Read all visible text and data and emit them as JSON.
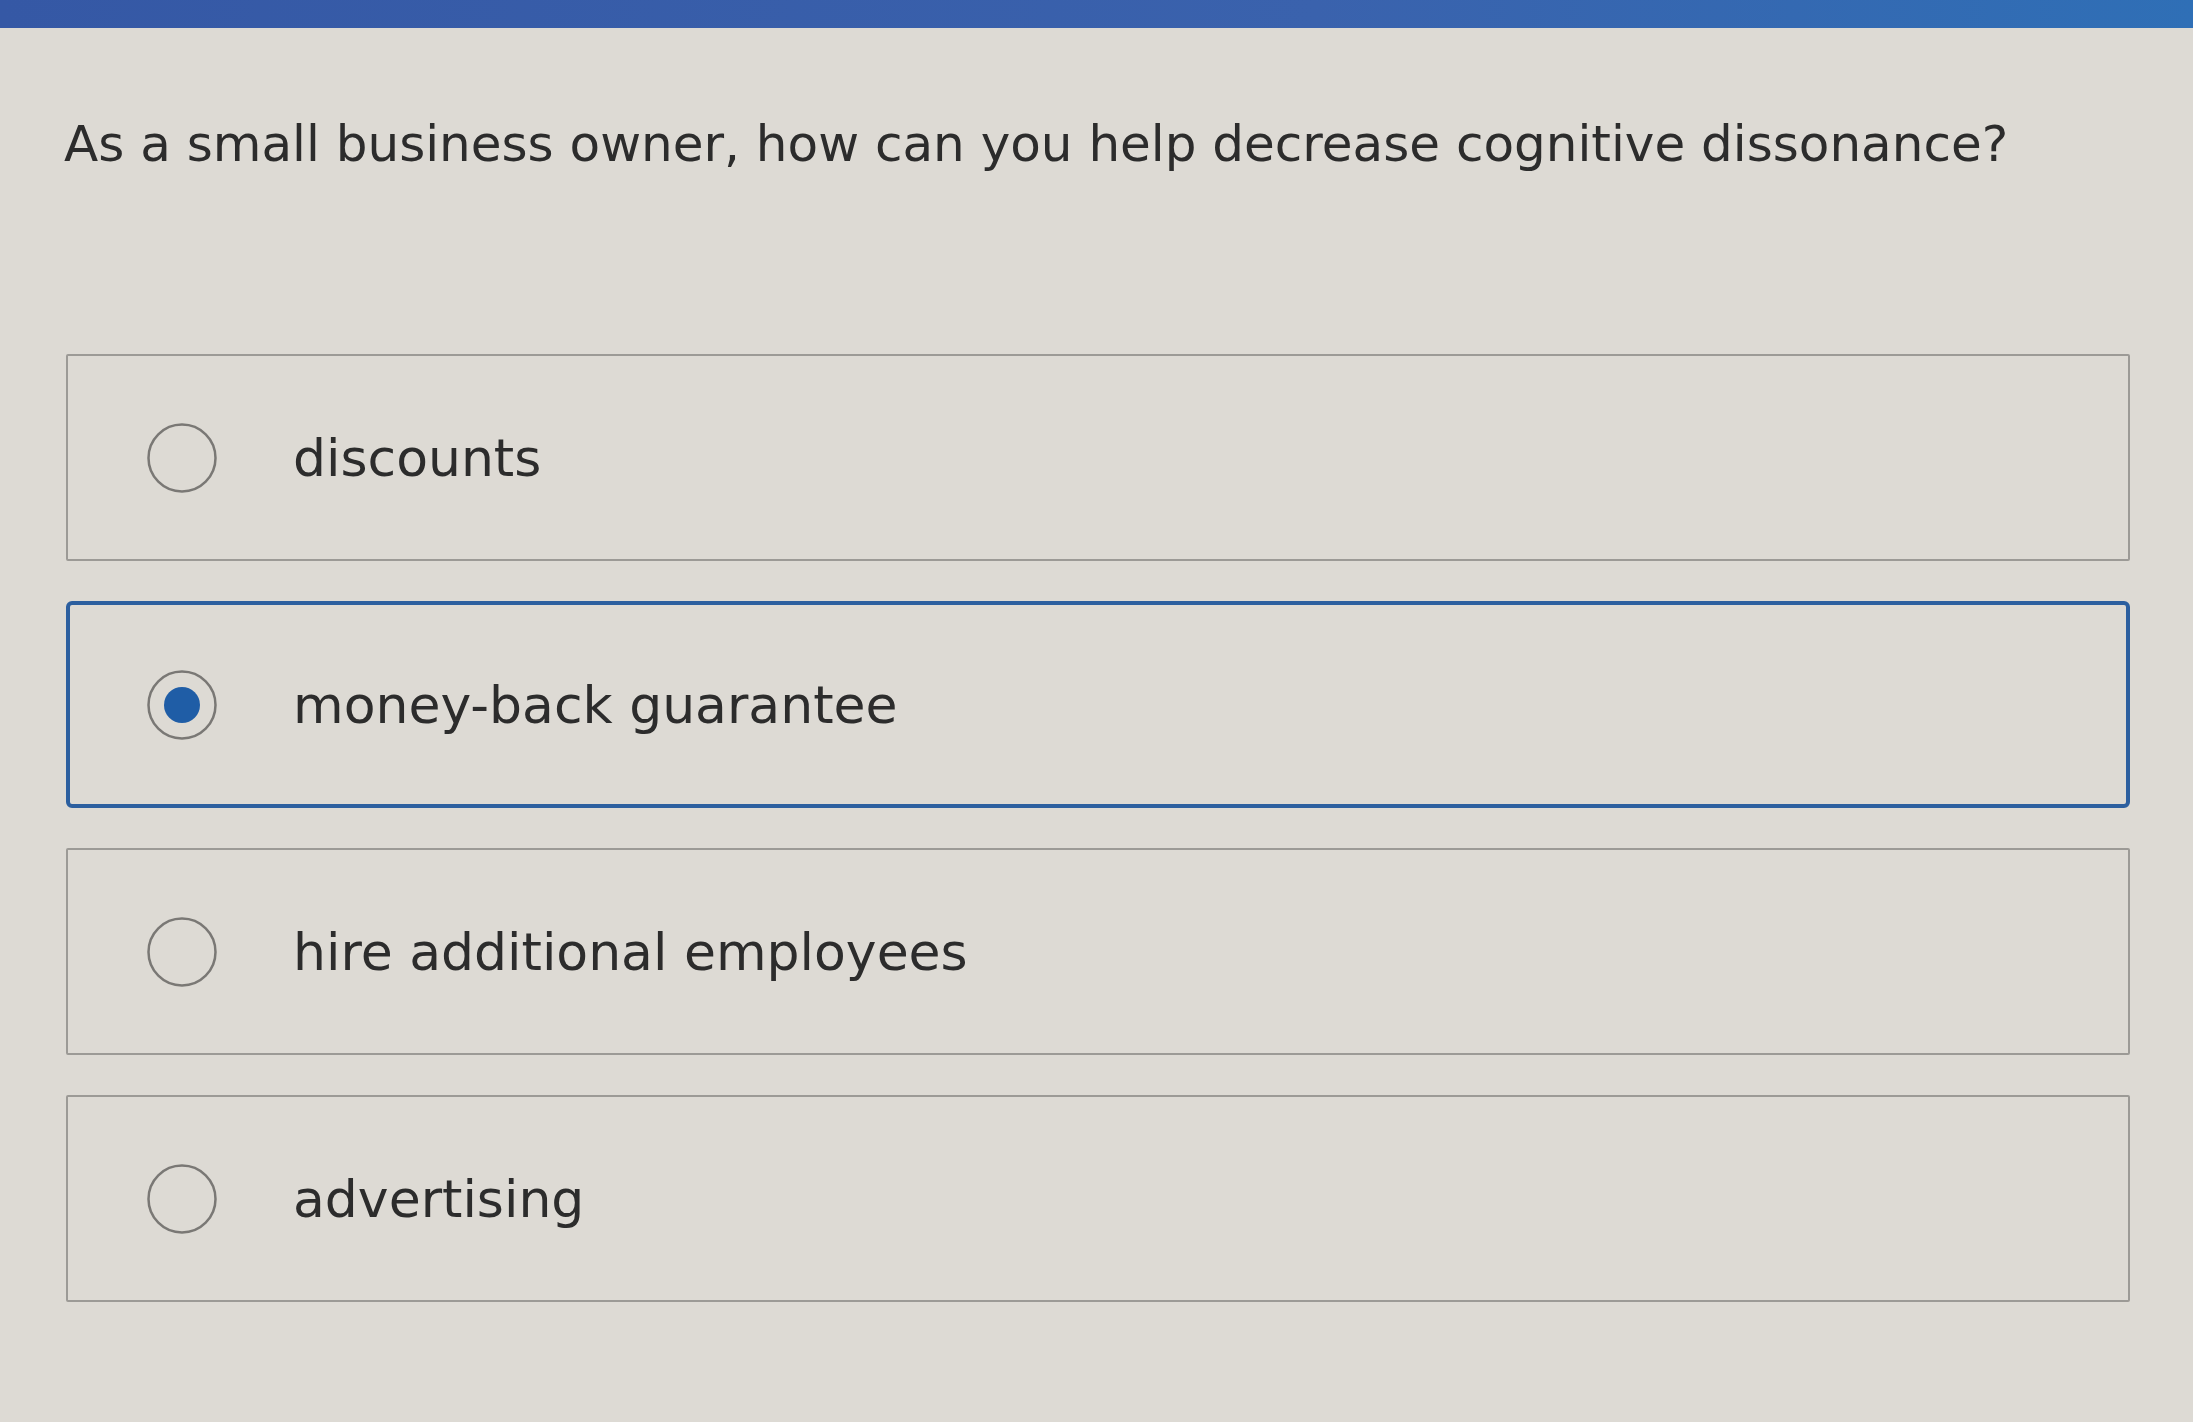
{
  "question": "As a small business owner, how can you help decrease cognitive dissonance?",
  "options": [
    {
      "label": "discounts",
      "selected": false
    },
    {
      "label": "money-back guarantee",
      "selected": true
    },
    {
      "label": "hire additional employees",
      "selected": false
    },
    {
      "label": "advertising",
      "selected": false
    }
  ]
}
